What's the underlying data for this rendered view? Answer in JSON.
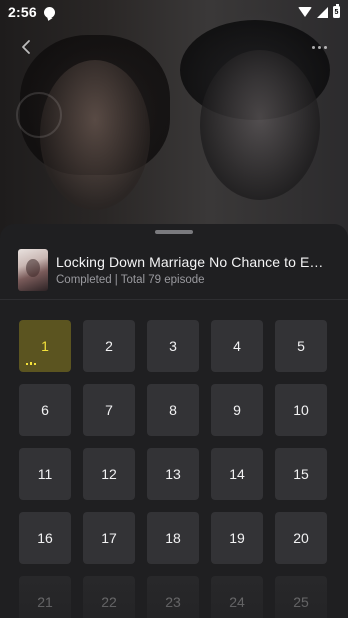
{
  "status_bar": {
    "time": "2:56",
    "battery": "5"
  },
  "series": {
    "title": "Locking Down Marriage No Chance to Escape",
    "subtitle": "Completed | Total 79 episode"
  },
  "episodes": [
    {
      "label": "1"
    },
    {
      "label": "2"
    },
    {
      "label": "3"
    },
    {
      "label": "4"
    },
    {
      "label": "5"
    },
    {
      "label": "6"
    },
    {
      "label": "7"
    },
    {
      "label": "8"
    },
    {
      "label": "9"
    },
    {
      "label": "10"
    },
    {
      "label": "11"
    },
    {
      "label": "12"
    },
    {
      "label": "13"
    },
    {
      "label": "14"
    },
    {
      "label": "15"
    },
    {
      "label": "16"
    },
    {
      "label": "17"
    },
    {
      "label": "18"
    },
    {
      "label": "19"
    },
    {
      "label": "20"
    },
    {
      "label": "21"
    },
    {
      "label": "22"
    },
    {
      "label": "23"
    },
    {
      "label": "24"
    },
    {
      "label": "25"
    }
  ],
  "current_episode": "1",
  "colors": {
    "active_bg": "#5b5420",
    "active_text": "#f4e23a",
    "tile_bg": "#333336",
    "sheet_bg": "#1f1f21"
  },
  "icons": {
    "back": "chevron-left-icon",
    "more": "more-horizontal-icon"
  }
}
